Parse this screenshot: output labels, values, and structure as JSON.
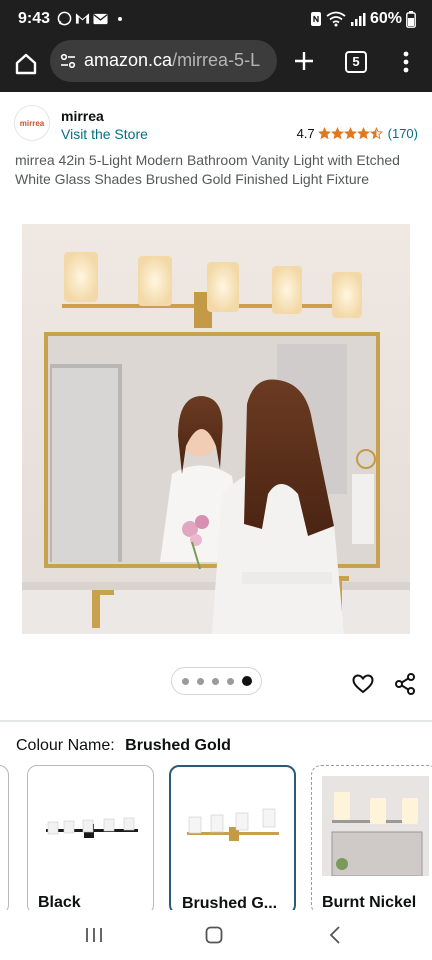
{
  "status_bar": {
    "time": "9:43",
    "battery": "60%",
    "icons_left": [
      "whatsapp-icon",
      "gmail-icon",
      "mail-icon",
      "dot-icon"
    ],
    "icons_right": [
      "nfc-icon",
      "wifi-icon",
      "signal-icon",
      "battery-icon"
    ]
  },
  "browser": {
    "url_host": "amazon.ca",
    "url_path": "/mirrea-5-L",
    "tab_count": "5"
  },
  "store": {
    "logo_text": "mirrea",
    "name": "mirrea",
    "visit_link": "Visit the Store",
    "rating": "4.7",
    "rating_stars": 4.5,
    "rating_count": "(170)"
  },
  "product": {
    "title": "mirrea 42in 5-Light Modern Bathroom Vanity Light with Etched White Glass Shades Brushed Gold Finished Light Fixture"
  },
  "carousel": {
    "count": 5,
    "active_index": 4
  },
  "colour": {
    "label": "Colour Name:",
    "selected": "Brushed Gold"
  },
  "swatches": [
    {
      "label": "Black"
    },
    {
      "label": "Brushed G..."
    },
    {
      "label": "Burnt Nickel"
    }
  ],
  "colors": {
    "accent_link": "#007185",
    "star": "#de7921",
    "selected_border": "#2b5a74",
    "chrome_bg": "#1f1f1f"
  }
}
